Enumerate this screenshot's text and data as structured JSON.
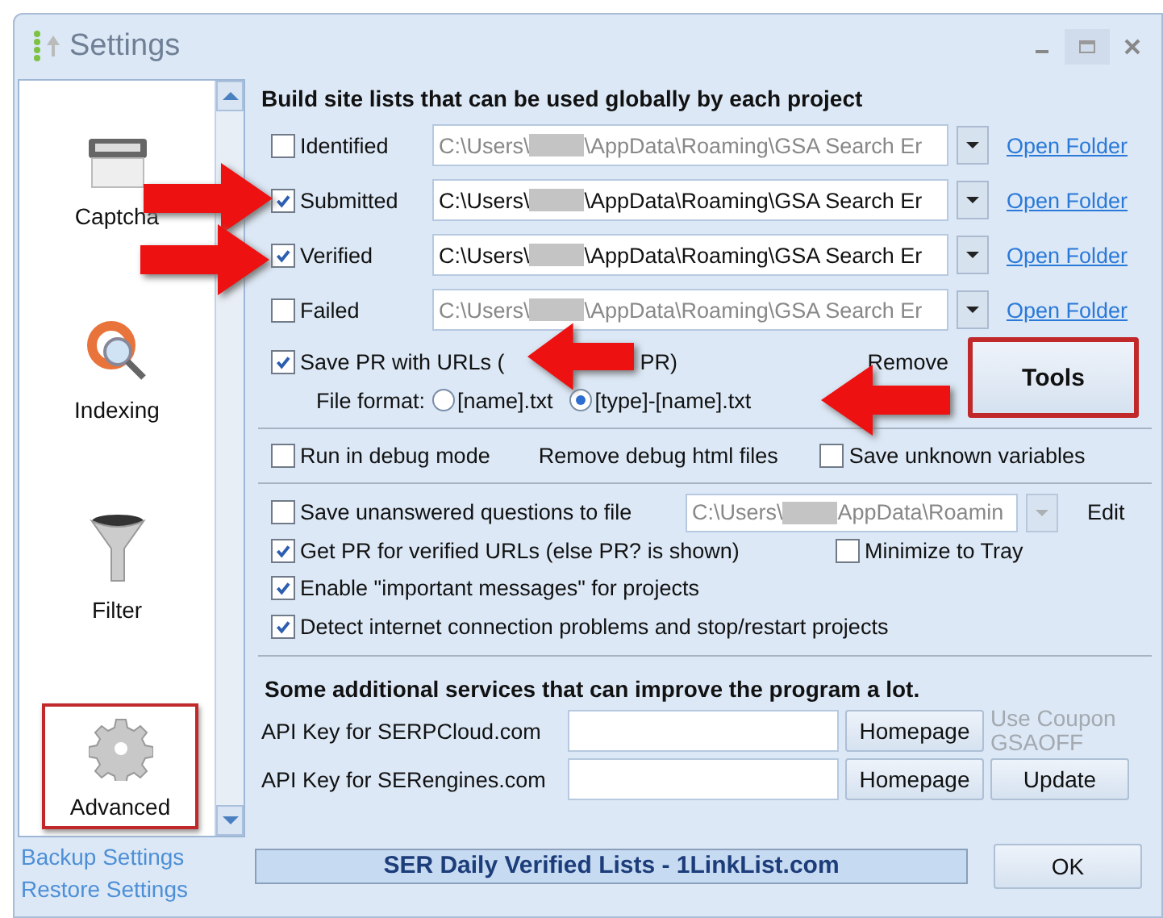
{
  "window": {
    "title": "Settings"
  },
  "sidebar": {
    "items": [
      {
        "kind": "captcha",
        "label": "Captcha",
        "selected": false
      },
      {
        "kind": "indexing",
        "label": "Indexing",
        "selected": false
      },
      {
        "kind": "filter",
        "label": "Filter",
        "selected": false
      },
      {
        "kind": "advanced",
        "label": "Advanced",
        "selected": true
      }
    ],
    "links": [
      "Backup Settings",
      "Restore Settings"
    ]
  },
  "site_lists": {
    "heading": "Build site lists that can be used globally by each project",
    "rows": [
      {
        "label": "Identified",
        "checked": false,
        "path_prefix": "C:\\Users\\",
        "path_suffix": "\\AppData\\Roaming\\GSA Search Er",
        "link": "Open Folder"
      },
      {
        "label": "Submitted",
        "checked": true,
        "path_prefix": "C:\\Users\\",
        "path_suffix": "\\AppData\\Roaming\\GSA Search Er",
        "link": "Open Folder"
      },
      {
        "label": "Verified",
        "checked": true,
        "path_prefix": "C:\\Users\\",
        "path_suffix": "\\AppData\\Roaming\\GSA Search Er",
        "link": "Open Folder"
      },
      {
        "label": "Failed",
        "checked": false,
        "path_prefix": "C:\\Users\\",
        "path_suffix": "\\AppData\\Roaming\\GSA Search Er",
        "link": "Open Folder"
      }
    ]
  },
  "save_pr": {
    "label_start": "Save PR with URLs (",
    "label_end": "PR)",
    "checked": true,
    "file_format_label": "File format:",
    "formats": [
      {
        "label": "[name].txt",
        "selected": false
      },
      {
        "label": "[type]-[name].txt",
        "selected": true
      }
    ],
    "remove_label": "Remove",
    "tools_button": "Tools"
  },
  "debug": {
    "run_label": "Run in debug mode",
    "run_checked": false,
    "remove_label": "Remove debug html files",
    "unknown_label": "Save unknown variables",
    "unknown_checked": false
  },
  "options": {
    "unanswered": {
      "label": "Save unanswered questions to file",
      "checked": false,
      "path_prefix": "C:\\Users\\",
      "path_suffix": "AppData\\Roamin",
      "edit": "Edit"
    },
    "minimize": {
      "label": "Minimize to Tray",
      "checked": false
    },
    "rows": [
      {
        "label": "Get PR for verified URLs (else PR? is shown)",
        "checked": true
      },
      {
        "label": "Enable \"important messages\" for projects",
        "checked": true
      },
      {
        "label": "Detect internet connection problems and stop/restart projects",
        "checked": true
      }
    ]
  },
  "services": {
    "heading": "Some additional services that can improve the program a lot.",
    "rows": [
      {
        "label": "API Key for SERPCloud.com",
        "button": "Homepage"
      },
      {
        "label": "API Key for SERengines.com",
        "button": "Homepage"
      }
    ],
    "coupon": [
      "Use Coupon",
      "GSAOFF"
    ],
    "update_button": "Update"
  },
  "footer": {
    "banner": "SER Daily Verified Lists - 1LinkList.com",
    "ok_button": "OK"
  }
}
